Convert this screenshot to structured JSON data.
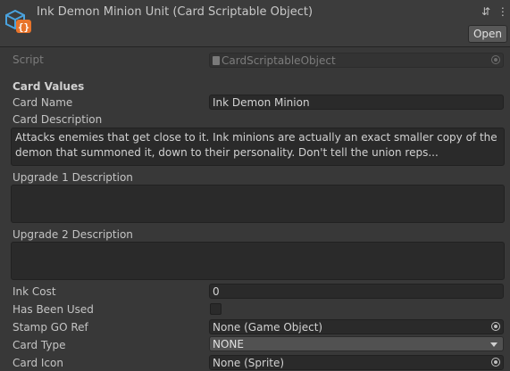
{
  "header": {
    "title": "Ink Demon Minion Unit (Card Scriptable Object)",
    "icon": "scriptable-object-icon",
    "open_label": "Open",
    "tools": "⇵ ⋮"
  },
  "script": {
    "label": "Script",
    "value": "CardScriptableObject"
  },
  "section": {
    "label": "Card Values"
  },
  "card_name": {
    "label": "Card Name",
    "value": "Ink Demon Minion"
  },
  "card_description": {
    "label": "Card Description",
    "value": "Attacks enemies that get close to it. Ink minions are actually an exact smaller copy of the demon that summoned it, down to their personality. Don't tell the union reps..."
  },
  "upgrade1": {
    "label": "Upgrade 1 Description",
    "value": ""
  },
  "upgrade2": {
    "label": "Upgrade 2 Description",
    "value": ""
  },
  "ink_cost": {
    "label": "Ink Cost",
    "value": "0"
  },
  "has_been_used": {
    "label": "Has Been Used",
    "checked": false
  },
  "stamp_go_ref": {
    "label": "Stamp GO Ref",
    "value": "None (Game Object)"
  },
  "card_type": {
    "label": "Card Type",
    "value": "NONE"
  },
  "card_icon": {
    "label": "Card Icon",
    "value": "None (Sprite)"
  },
  "colors": {
    "background": "#383838",
    "field": "#2a2a2a",
    "icon_blue": "#4aa3df",
    "icon_orange": "#e8742b"
  }
}
